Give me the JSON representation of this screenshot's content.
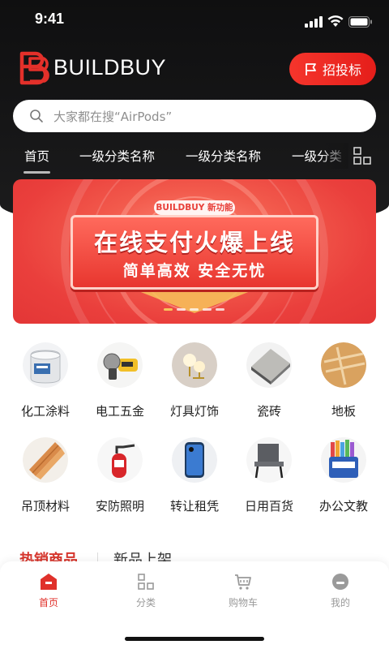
{
  "status": {
    "time": "9:41"
  },
  "header": {
    "brand": "BUILDBUY",
    "tender_label": "招投标"
  },
  "search": {
    "placeholder": "大家都在搜“AirPods”"
  },
  "tabs": [
    {
      "label": "首页"
    },
    {
      "label": "一级分类名称"
    },
    {
      "label": "一级分类名称"
    },
    {
      "label": "一级分类"
    }
  ],
  "banner": {
    "tag": "BUILDBUY 新功能",
    "headline": "在线支付火爆上线",
    "subline": "简单高效  安全无忧"
  },
  "categories": [
    {
      "label": "化工涂料",
      "icon": "paint-bucket-icon"
    },
    {
      "label": "电工五金",
      "icon": "angle-grinder-icon"
    },
    {
      "label": "灯具灯饰",
      "icon": "wall-lamp-icon"
    },
    {
      "label": "瓷砖",
      "icon": "tile-icon"
    },
    {
      "label": "地板",
      "icon": "wood-floor-icon"
    },
    {
      "label": "吊顶材料",
      "icon": "ceiling-panel-icon"
    },
    {
      "label": "安防照明",
      "icon": "fire-extinguisher-icon"
    },
    {
      "label": "转让租凭",
      "icon": "smartphone-icon"
    },
    {
      "label": "日用百货",
      "icon": "chair-icon"
    },
    {
      "label": "办公文教",
      "icon": "crayons-icon"
    }
  ],
  "sections": {
    "hot": "热销商品",
    "new": "新品上架"
  },
  "nav": [
    {
      "label": "首页",
      "icon": "home-icon",
      "active": true
    },
    {
      "label": "分类",
      "icon": "category-grid-icon",
      "active": false
    },
    {
      "label": "购物车",
      "icon": "cart-icon",
      "active": false
    },
    {
      "label": "我的",
      "icon": "profile-icon",
      "active": false
    }
  ],
  "colors": {
    "accent": "#E0312B",
    "header_bg": "#141415",
    "banner_red": "#EA3F3C"
  }
}
